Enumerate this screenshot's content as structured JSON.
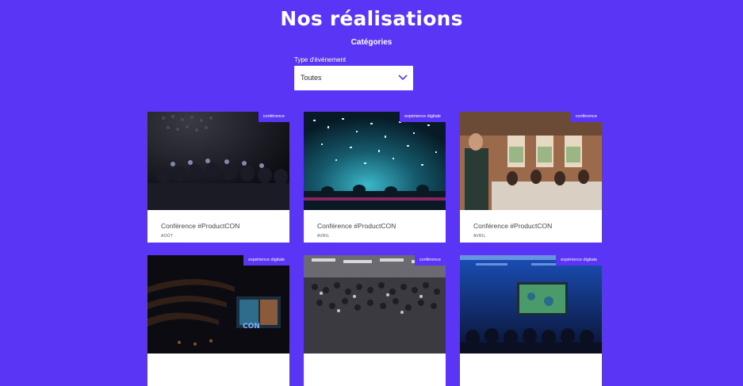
{
  "page": {
    "title": "Nos réalisations",
    "categories_label": "Catégories"
  },
  "filter": {
    "label": "Type d'événement",
    "selected": "Toutes"
  },
  "cards": [
    {
      "tag": "conférence",
      "title": "Conférence #ProductCON",
      "date": "AOÛT"
    },
    {
      "tag": "expérience digitale",
      "title": "Conférence #ProductCON",
      "date": "AVRIL"
    },
    {
      "tag": "conférence",
      "title": "Conférence #ProductCON",
      "date": "AVRIL"
    },
    {
      "tag": "expérience digitale"
    },
    {
      "tag": "conférence"
    },
    {
      "tag": "expérience digitale"
    }
  ],
  "colors": {
    "background": "#5b35f5",
    "card": "#ffffff",
    "accent": "#5b35f5"
  }
}
